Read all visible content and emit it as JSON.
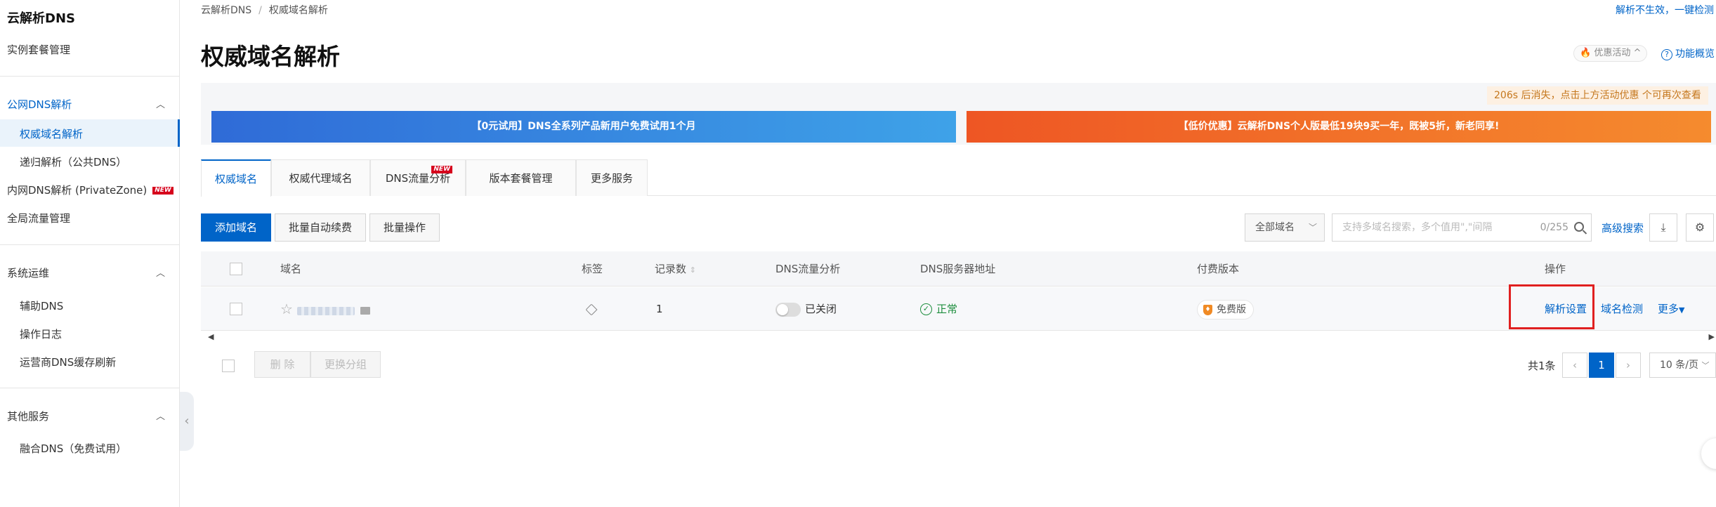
{
  "sidebar": {
    "title": "云解析DNS",
    "items": {
      "instance_mgmt": "实例套餐管理",
      "public_dns": "公网DNS解析",
      "authoritative": "权威域名解析",
      "recursive": "递归解析（公共DNS）",
      "private_zone": "内网DNS解析 (PrivateZone)",
      "private_zone_badge": "NEW",
      "traffic": "全局流量管理",
      "ops": "系统运维",
      "assist_dns": "辅助DNS",
      "op_log": "操作日志",
      "cache_refresh": "运营商DNS缓存刷新",
      "other": "其他服务",
      "fusion_dns": "融合DNS（免费试用）"
    }
  },
  "header": {
    "breadcrumb": [
      "云解析DNS",
      "权威域名解析"
    ],
    "breadcrumb_sep": "/",
    "top_right_link": "解析不生效，一键检测",
    "page_title": "权威域名解析",
    "promo_pill": "优惠活动",
    "help_link": "功能概览"
  },
  "banners": {
    "countdown": "206s 后消失，点击上方活动优惠 个可再次查看",
    "left": "【0元试用】DNS全系列产品新用户免费试用1个月",
    "right": "【低价优惠】云解析DNS个人版最低19块9买一年，既被5折，新老同享!"
  },
  "tabs": [
    {
      "label": "权威域名",
      "active": true
    },
    {
      "label": "权威代理域名",
      "active": false
    },
    {
      "label": "DNS流量分析",
      "active": false,
      "badge": "NEW"
    },
    {
      "label": "版本套餐管理",
      "active": false
    },
    {
      "label": "更多服务",
      "active": false
    }
  ],
  "toolbar": {
    "add_domain": "添加域名",
    "batch_renew": "批量自动续费",
    "batch_ops": "批量操作",
    "domain_filter": "全部域名",
    "search_placeholder": "支持多域名搜索，多个值用\",\"间隔",
    "search_count": "0/255",
    "advanced_search": "高级搜索"
  },
  "table": {
    "columns": {
      "domain": "域名",
      "tag": "标签",
      "records": "记录数",
      "traffic": "DNS流量分析",
      "dns_server": "DNS服务器地址",
      "edition": "付费版本",
      "actions": "操作"
    },
    "rows": [
      {
        "records": "1",
        "traffic_status": "已关闭",
        "dns_status": "正常",
        "edition": "免费版",
        "actions": {
          "settings": "解析设置",
          "check": "域名检测",
          "more": "更多"
        }
      }
    ]
  },
  "footer": {
    "delete": "删 除",
    "change_group": "更换分组",
    "total": "共1条",
    "current_page": "1",
    "page_size": "10 条/页"
  },
  "colors": {
    "accent": "#0064c8",
    "highlight": "#e02020",
    "ok": "#1e8e3e"
  }
}
